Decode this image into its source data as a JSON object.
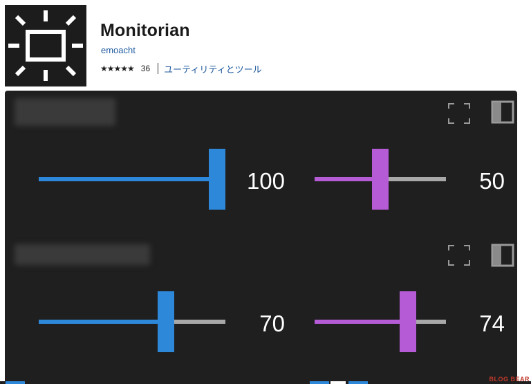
{
  "app": {
    "title": "Monitorian",
    "publisher": "emoacht",
    "rating_stars": "★★★★★",
    "rating_count": "36",
    "category": "ユーティリティとツール",
    "icon": "monitorian-sun-icon"
  },
  "monitors": [
    {
      "name": "",
      "brightness_value": "100",
      "brightness_level": 100,
      "contrast_value": "50",
      "contrast_level": 50
    },
    {
      "name": "",
      "brightness_value": "70",
      "brightness_level": 70,
      "contrast_value": "74",
      "contrast_level": 74
    }
  ],
  "colors": {
    "brightness_accent": "#2d88d9",
    "contrast_accent": "#b55bd6",
    "track_empty": "#a8a8a8",
    "panel_bg": "#1f1f1f"
  },
  "header_icons": [
    "fullscreen-icon",
    "panel-icon"
  ],
  "watermark": "BLOG BEAR"
}
